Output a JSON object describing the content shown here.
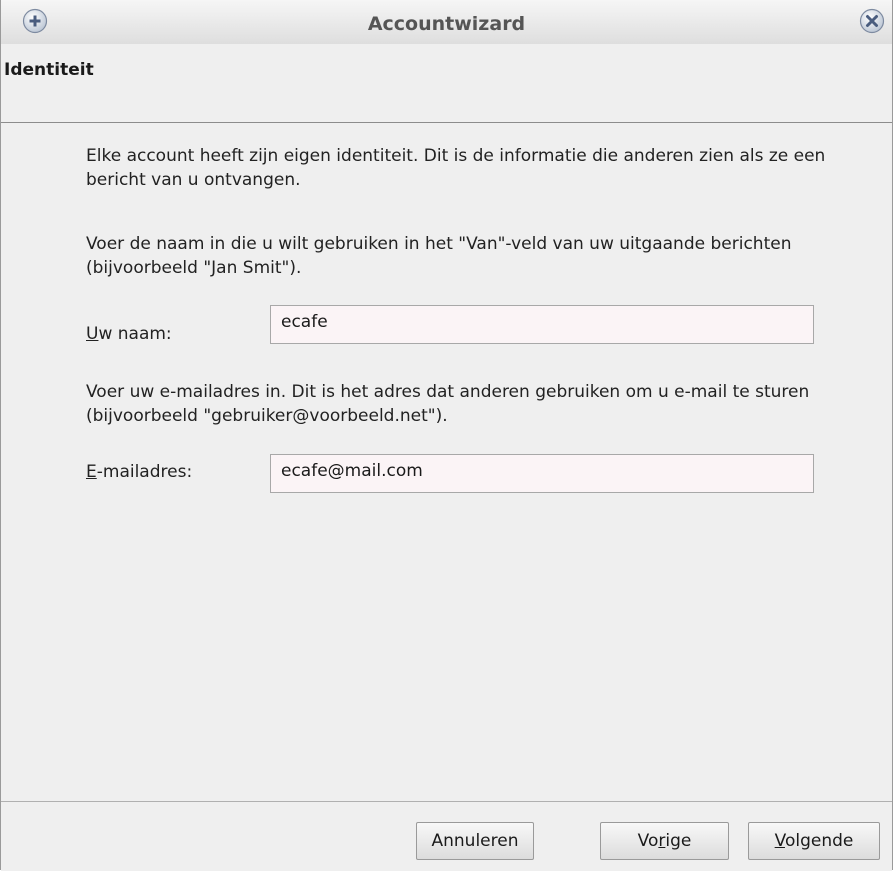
{
  "window": {
    "title": "Accountwizard"
  },
  "page": {
    "title": "Identiteit",
    "intro": "Elke account heeft zijn eigen identiteit. Dit is de informatie die anderen zien als ze een bericht van u ontvangen.",
    "name_instructions": "Voer de naam in die u wilt gebruiken in het \"Van\"-veld van uw uitgaande berichten (bijvoorbeeld \"Jan Smit\").",
    "email_instructions": "Voer uw e-mailadres in. Dit is het adres dat anderen gebruiken om u e-mail te sturen (bijvoorbeeld \"gebruiker@voorbeeld.net\")."
  },
  "form": {
    "name": {
      "label_access_key": "U",
      "label_rest": "w naam:",
      "value": "ecafe"
    },
    "email": {
      "label_access_key": "E",
      "label_rest": "-mailadres:",
      "value": "ecafe@mail.com"
    }
  },
  "buttons": {
    "cancel": "Annuleren",
    "back_pre": "Vo",
    "back_key": "r",
    "back_post": "ige",
    "next_key": "V",
    "next_post": "olgende"
  },
  "icons": {
    "titlebar_left": "plus-icon",
    "titlebar_right": "close-icon"
  }
}
